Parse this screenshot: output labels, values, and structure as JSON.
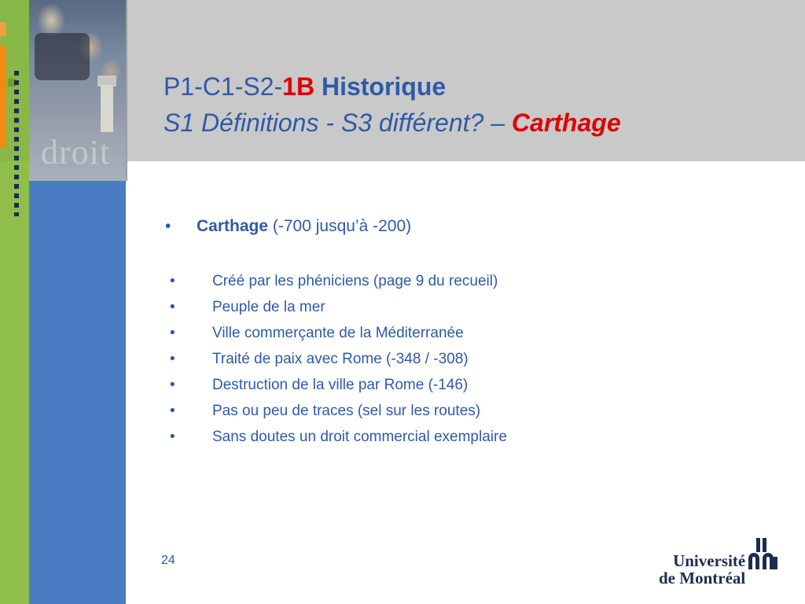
{
  "slide": {
    "title_prefix": "P1-C1-S2-",
    "title_highlight": "1B",
    "title_rest": " Historique",
    "subtitle_prefix": "S1 Définitions - S3 différent? – ",
    "subtitle_highlight": "Carthage",
    "decor_word": "droit",
    "main_bullet": {
      "glyph": "•",
      "bold": "Carthage",
      "rest": " (-700 jusqu’à -200)"
    },
    "sub_items": [
      {
        "glyph": "•",
        "text": "Créé par les phéniciens (page 9 du recueil)"
      },
      {
        "glyph": "•",
        "text": "Peuple de la mer"
      },
      {
        "glyph": "•",
        "text": "Ville commerçante de la Méditerranée"
      },
      {
        "glyph": "•",
        "text": "Traité de paix avec Rome (-348 / -308)"
      },
      {
        "glyph": "•",
        "text": "Destruction de la ville par Rome (-146)"
      },
      {
        "glyph": "•",
        "text": "Pas ou peu de traces (sel sur les routes)"
      },
      {
        "glyph": "•",
        "text": "Sans doutes un droit commercial exemplaire"
      }
    ],
    "page_number": "24"
  },
  "logo": {
    "line1": "Université",
    "line2": "de Montréal"
  },
  "colors": {
    "title_blue": "#2e5aa8",
    "highlight_red": "#e00000",
    "header_gray": "#c9c9c9",
    "panel_blue": "#4a7cc4",
    "panel_green": "#8fbe4a",
    "accent_orange": "#f08a10",
    "logo_navy": "#1c2c50"
  }
}
